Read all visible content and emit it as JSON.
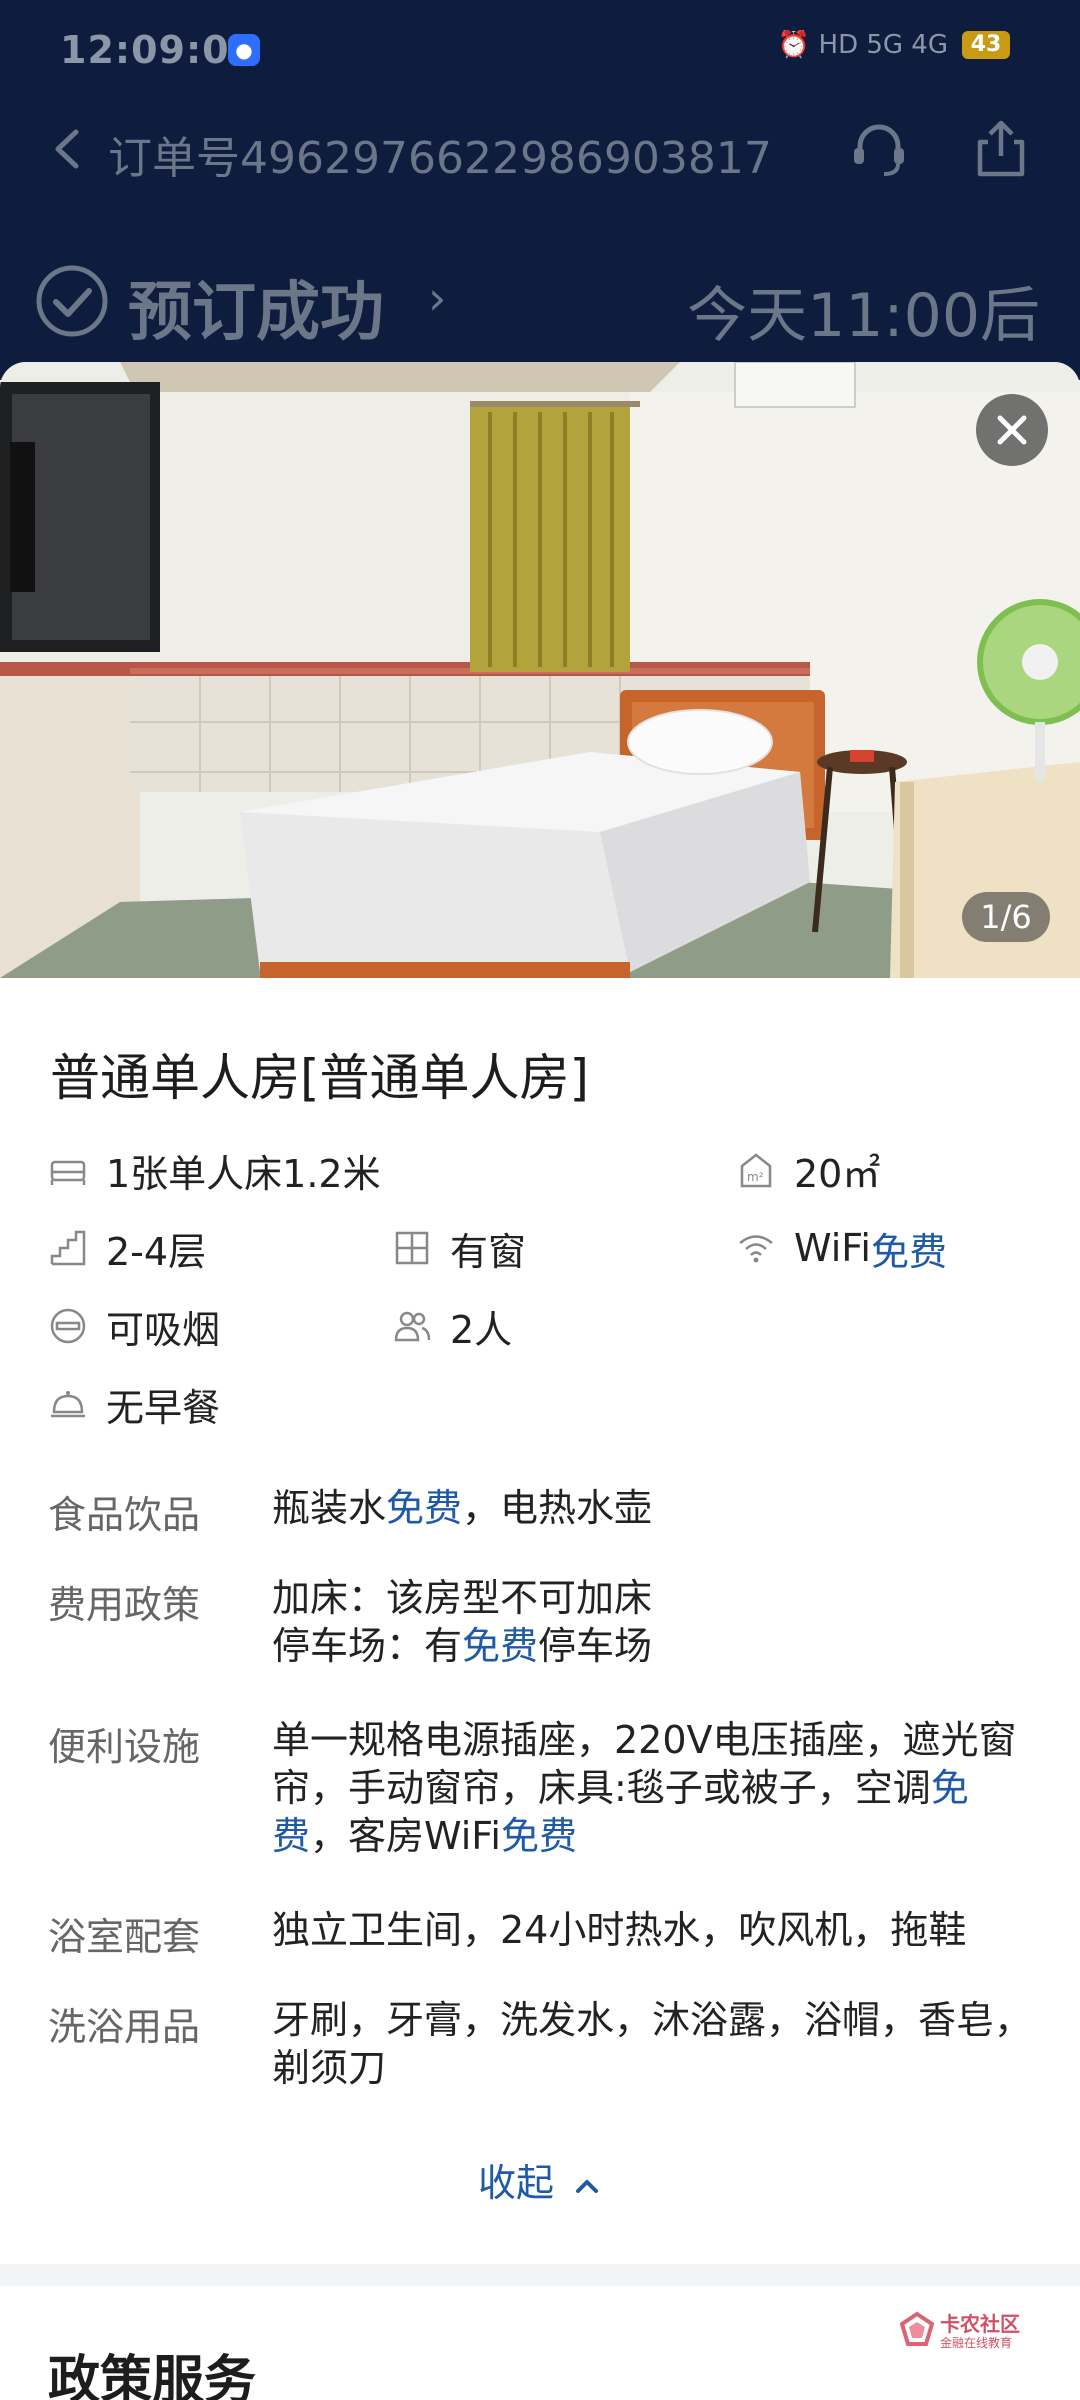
{
  "status_bar": {
    "time": "12:09:07",
    "app_icon": "qq-bubble-icon",
    "indicators": "⏰ HD 5G 4G",
    "battery": "43"
  },
  "nav": {
    "back_icon": "chevron-left-icon",
    "order_label": "订单号",
    "order_number": "4962976622986903817",
    "service_icon": "headset-icon",
    "share_icon": "share-icon"
  },
  "booking": {
    "status": "预订成功",
    "checkin": "今天11:00后"
  },
  "gallery": {
    "counter": "1/6",
    "close_icon": "close-icon"
  },
  "room": {
    "title": "普通单人房[普通单人房]",
    "features": {
      "bed": "1张单人床1.2米",
      "area": "20㎡",
      "floor": "2-4层",
      "window": "有窗",
      "wifi_prefix": "WiFi",
      "wifi_free": "免费",
      "smoking": "可吸烟",
      "occupancy": "2人",
      "breakfast": "无早餐"
    },
    "details": [
      {
        "label": "食品饮品",
        "line1a": "瓶装水",
        "line1b": "免费",
        "line1c": "，电热水壶"
      },
      {
        "label": "费用政策",
        "line1": "加床：该房型不可加床",
        "line2a": "停车场：有",
        "line2b": "免费",
        "line2c": "停车场"
      },
      {
        "label": "便利设施",
        "a": "单一规格电源插座，220V电压插座，遮光窗帘，手动窗帘，床具:毯子或被子，空调",
        "b": "免费",
        "c": "，客房WiFi",
        "d": "免费"
      },
      {
        "label": "浴室配套",
        "value": "独立卫生间，24小时热水，吹风机，拖鞋"
      },
      {
        "label": "洗浴用品",
        "value": "牙刷，牙膏，洗发水，沐浴露，浴帽，香皂，剃须刀"
      }
    ],
    "collapse_label": "收起"
  },
  "policy": {
    "title": "政策服务"
  },
  "watermark": {
    "name": "卡农社区",
    "sub": "金融在线教育"
  },
  "colors": {
    "header_bg": "#0e1c3d",
    "link_blue": "#1f5aa6"
  }
}
